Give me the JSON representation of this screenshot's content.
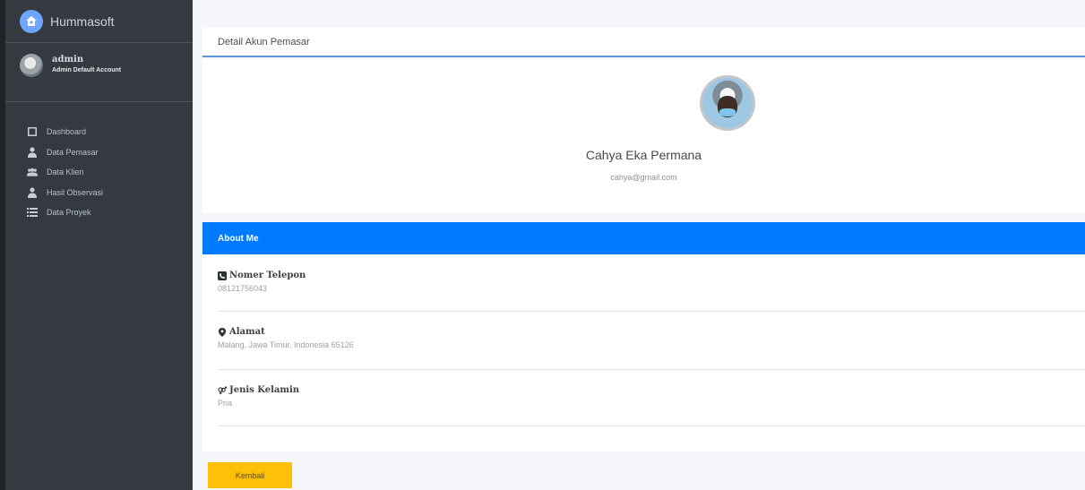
{
  "sidebar": {
    "brand": {
      "name": "Hummasoft",
      "color": "#6fa5ff"
    },
    "user": {
      "name": "admin",
      "role": "Admin Default Account"
    },
    "items": [
      {
        "label": "Dashboard",
        "icon": "dashboard-icon"
      },
      {
        "label": "Data Pemasar",
        "icon": "user-tie-icon"
      },
      {
        "label": "Data Klien",
        "icon": "users-icon"
      },
      {
        "label": "Hasil Observasi",
        "icon": "user-tie-icon"
      },
      {
        "label": "Data Proyek",
        "icon": "list-icon"
      }
    ]
  },
  "main": {
    "card_title": "Detail Akun Pemasar",
    "profile": {
      "name": "Cahya Eka Permana",
      "email": "cahya@gmail.com"
    },
    "about": {
      "title": "About Me",
      "header_color": "#007bff",
      "fields": [
        {
          "label": "Nomer Telepon",
          "value": "08121756043",
          "icon": "phone-square-icon"
        },
        {
          "label": "Alamat",
          "value": "Malang, Jawa Timur, Indonesia 65126",
          "icon": "map-marker-icon"
        },
        {
          "label": "Jenis Kelamin",
          "value": "Pria",
          "icon": "venus-mars-icon"
        }
      ]
    },
    "back_button": {
      "label": "Kembali",
      "color": "#ffc107"
    }
  }
}
